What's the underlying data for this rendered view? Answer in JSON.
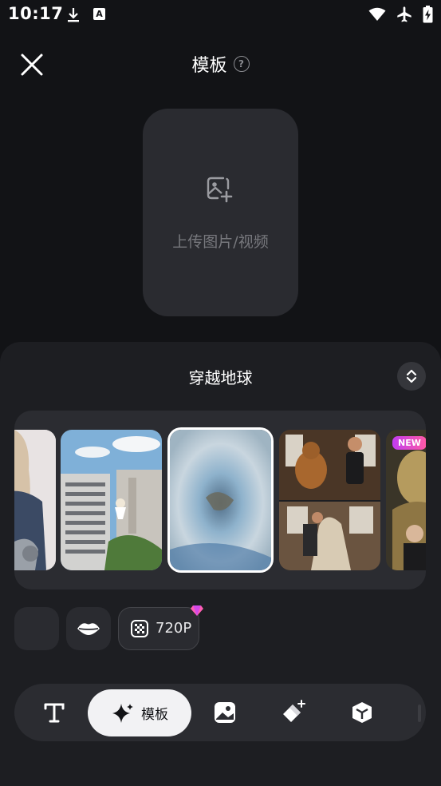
{
  "status_bar": {
    "time": "10:17"
  },
  "header": {
    "title": "模板",
    "help_symbol": "?"
  },
  "upload": {
    "label": "上传图片/视频"
  },
  "panel": {
    "template_name": "穿越地球",
    "thumbnails": [
      {
        "name": "knight-woman"
      },
      {
        "name": "city-building-jump"
      },
      {
        "name": "earth-zoom",
        "selected": true
      },
      {
        "name": "capybara-dance"
      },
      {
        "name": "buddha-statue",
        "badge": "NEW"
      }
    ]
  },
  "tools": {
    "resolution_label": "720P"
  },
  "toolbar": {
    "active_label": "模板"
  },
  "colors": {
    "background": "#121316",
    "panel": "#1d1e22",
    "card": "#2a2b30",
    "accent_new": "#d449e8"
  }
}
